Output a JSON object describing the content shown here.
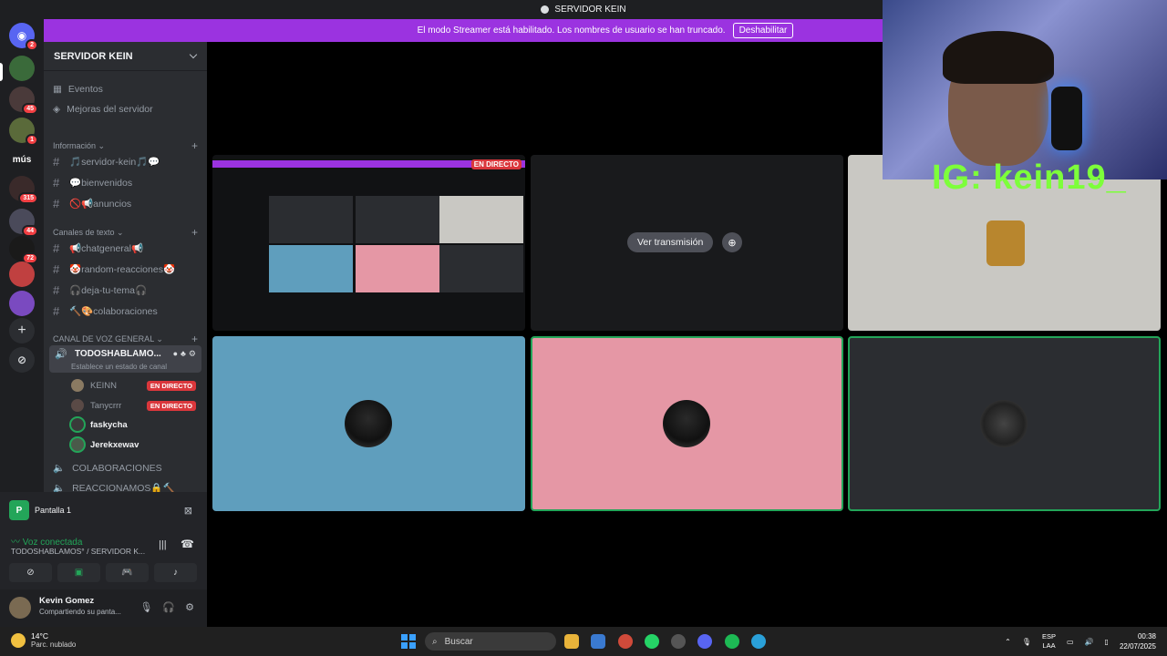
{
  "window": {
    "title": "SERVIDOR KEIN"
  },
  "banner": {
    "text": "El modo Streamer está habilitado. Los nombres de usuario se han truncado.",
    "button": "Deshabilitar"
  },
  "rail": {
    "items": [
      {
        "name": "discord-home",
        "badge": "2"
      },
      {
        "name": "server-1",
        "badge": ""
      },
      {
        "name": "server-2",
        "badge": "45"
      },
      {
        "name": "server-3",
        "badge": "1"
      },
      {
        "name": "server-mus",
        "label": "mús"
      },
      {
        "name": "server-5",
        "badge": "315"
      },
      {
        "name": "server-6",
        "badge": "44"
      },
      {
        "name": "server-7",
        "badge": "72"
      },
      {
        "name": "server-8",
        "badge": ""
      },
      {
        "name": "server-9",
        "badge": ""
      }
    ]
  },
  "sidebar": {
    "server_name": "SERVIDOR KEIN",
    "events": "Eventos",
    "boosts": "Mejoras del servidor",
    "cat_info": "Información",
    "info_channels": [
      "🎵servidor-kein🎵💬",
      "💬bienvenidos",
      "🚫📢anuncios"
    ],
    "cat_text": "Canales de texto",
    "text_channels": [
      "📢chatgeneral📢",
      "🤡random-reacciones🤡",
      "🎧deja-tu-tema🎧",
      "🔨🎨colaboraciones"
    ],
    "cat_voice": "CANAL DE VOZ GENERAL",
    "voice_channel": "TODOSHABLAMO...",
    "voice_status": "Establece un estado de canal",
    "members": [
      {
        "name": "KEINN",
        "live": "EN DIRECTO",
        "color": "#8a7a62"
      },
      {
        "name": "Tanycrrr",
        "live": "EN DIRECTO",
        "color": "#5a4a46"
      },
      {
        "name": "faskycha",
        "live": "",
        "color": "#3a3a3a"
      },
      {
        "name": "Jerekxewav",
        "live": "",
        "color": "#4a5a4a"
      }
    ],
    "voice_more": [
      "COLABORACIONES",
      "REACCIONAMOS🔒🔨"
    ]
  },
  "voicepanel": {
    "screen_label": "Pantalla 1",
    "connected": "Voz conectada",
    "connected_sub": "TODOSHABLAMOS° / SERVIDOR K...",
    "user_name": "Kevin Gomez",
    "user_status": "Compartiendo su panta..."
  },
  "stage": {
    "live_tag": "EN DIRECTO",
    "watch_button": "Ver transmisión",
    "tile_colors": {
      "blue": "#5f9ebd",
      "pink": "#e597a5",
      "dark": "#2b2d31",
      "light": "#c9c8c3"
    }
  },
  "overlay": {
    "ig_text": "IG: kein19_"
  },
  "taskbar": {
    "weather_temp": "14°C",
    "weather_desc": "Parc. nublado",
    "search_placeholder": "Buscar",
    "lang1": "ESP",
    "lang2": "LAA",
    "time": "00:38",
    "date": "22/07/2025"
  }
}
